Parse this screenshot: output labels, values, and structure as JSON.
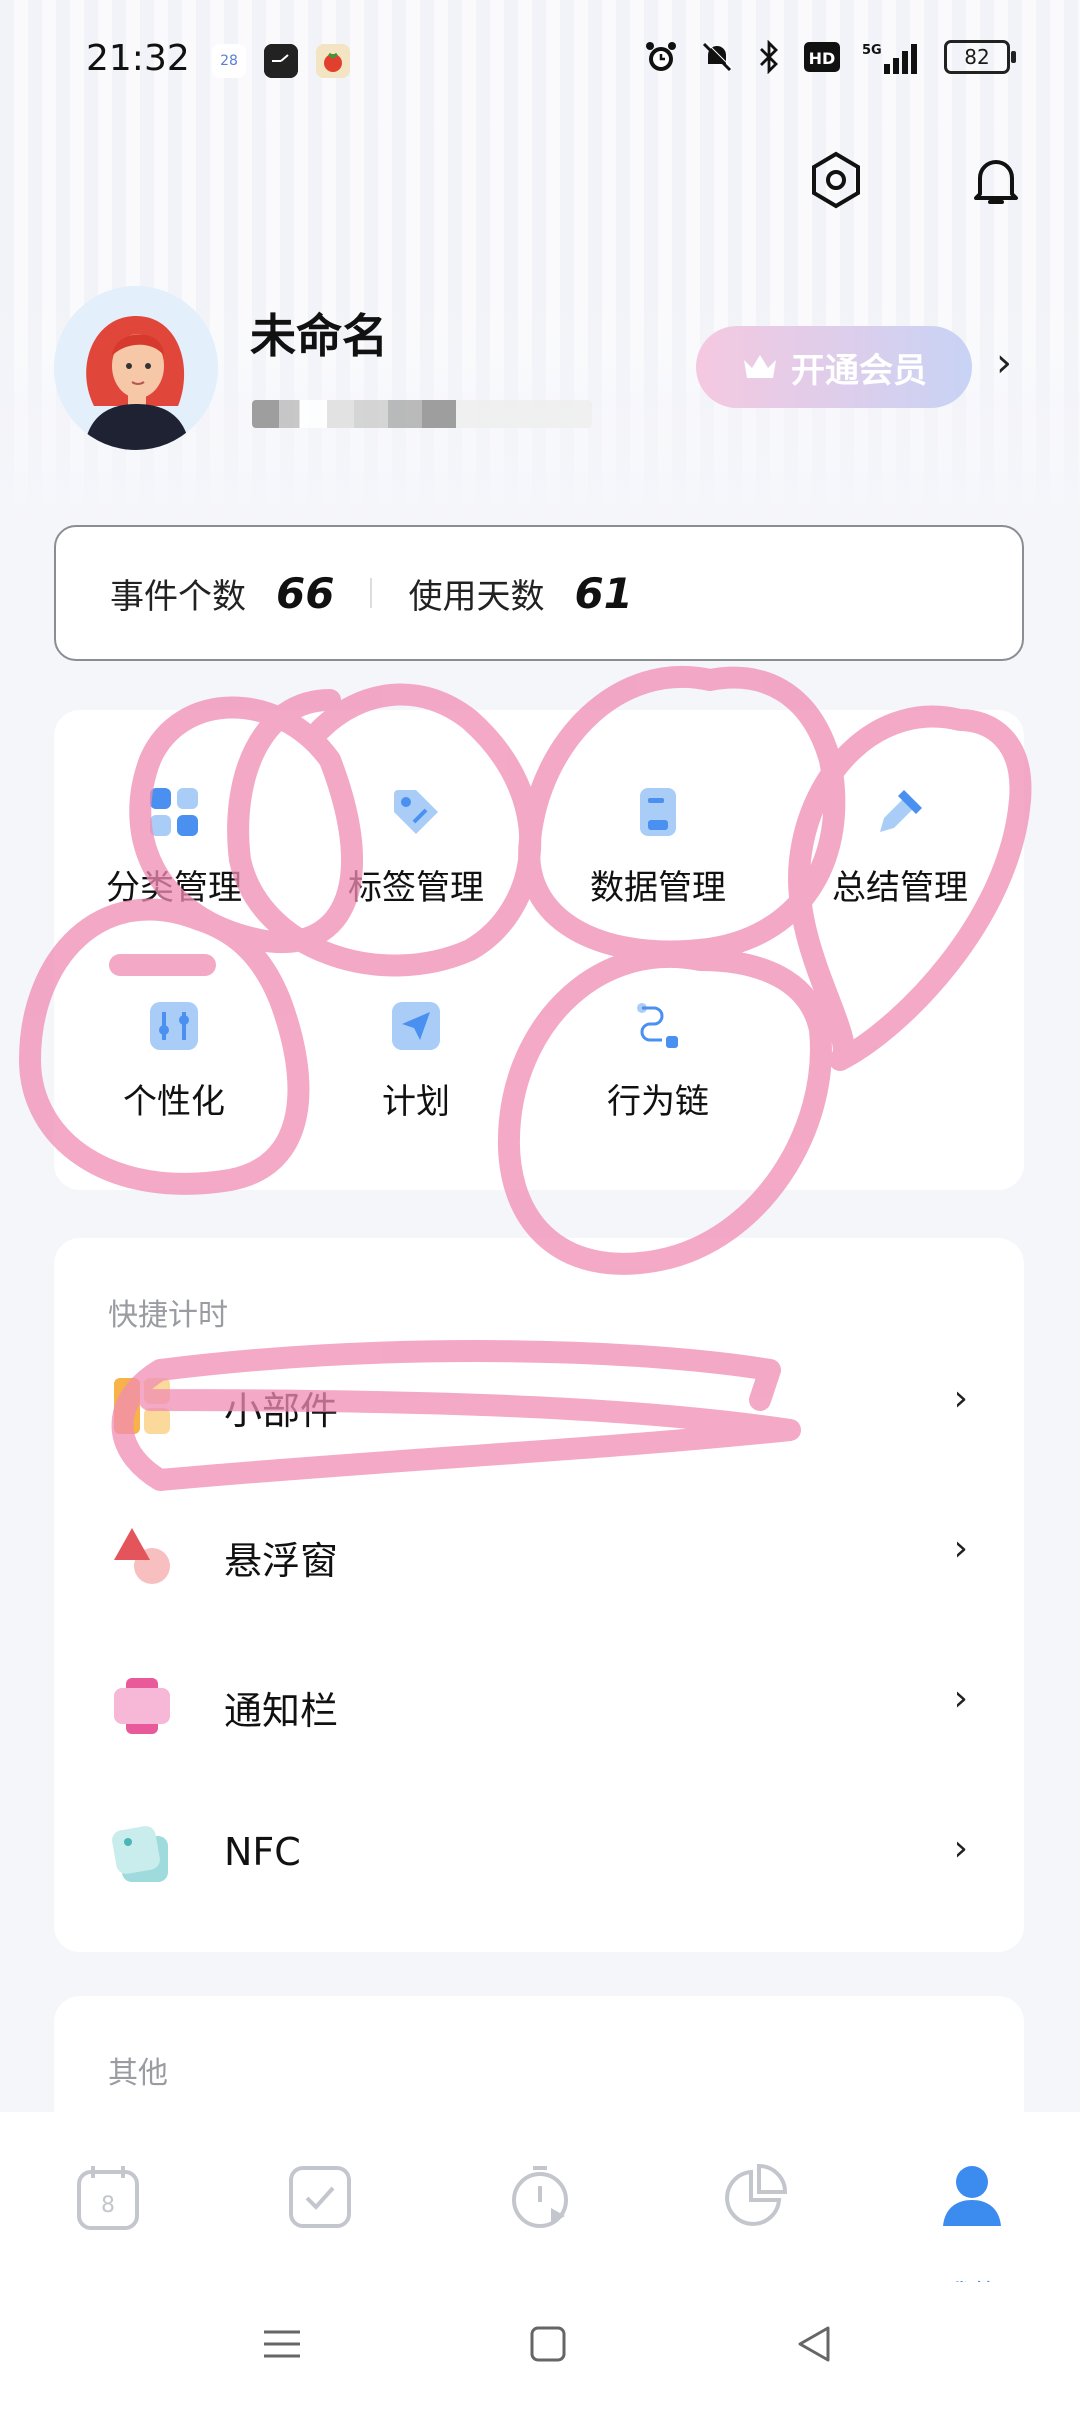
{
  "status_bar": {
    "time": "21:32",
    "app_icon_1": "28",
    "battery": "82",
    "icons": [
      "alarm-icon",
      "mute-icon",
      "bluetooth-icon",
      "hd-icon",
      "signal-5g-icon"
    ]
  },
  "header": {
    "settings_icon": "settings-hexagon-icon",
    "bell_icon": "bell-icon"
  },
  "profile": {
    "name": "未命名",
    "vip_label": "开通会员"
  },
  "stats": {
    "events_label": "事件个数",
    "events_value": "66",
    "days_label": "使用天数",
    "days_value": "61"
  },
  "grid": {
    "items": [
      {
        "label": "分类管理",
        "icon": "category-icon"
      },
      {
        "label": "标签管理",
        "icon": "tag-icon"
      },
      {
        "label": "数据管理",
        "icon": "data-icon"
      },
      {
        "label": "总结管理",
        "icon": "summary-icon"
      },
      {
        "label": "个性化",
        "icon": "personalize-icon"
      },
      {
        "label": "计划",
        "icon": "plan-icon"
      },
      {
        "label": "行为链",
        "icon": "behavior-chain-icon"
      }
    ]
  },
  "quick_timer": {
    "title": "快捷计时",
    "rows": [
      {
        "label": "小部件",
        "icon": "widget-icon"
      },
      {
        "label": "悬浮窗",
        "icon": "floating-window-icon"
      },
      {
        "label": "通知栏",
        "icon": "notification-bar-icon"
      },
      {
        "label": "NFC",
        "icon": "nfc-icon"
      }
    ]
  },
  "other": {
    "title": "其他"
  },
  "bottom_nav": {
    "calendar_day": "8",
    "active_label": "我的"
  },
  "colors": {
    "accent": "#3c8cf0",
    "scribble": "#f08cb4"
  }
}
